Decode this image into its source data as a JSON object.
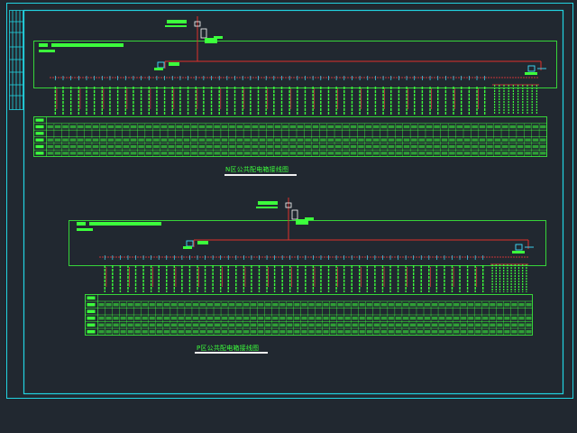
{
  "colors": {
    "background": "#212830",
    "frame": "#22d3e0",
    "wire": "#3cff3c",
    "bus": "#e0302a",
    "accent_red": "#ff3a3a",
    "accent_cyan": "#40e0ff",
    "title_line": "#f0f0f0"
  },
  "diagrams": [
    {
      "title": "N区公共配电箱接线图",
      "columns": 56,
      "tail_columns": 10
    },
    {
      "title": "P区公共配电箱接线图",
      "columns": 50,
      "tail_columns": 10
    }
  ],
  "icons": [
    "breaker-icon",
    "meter-icon",
    "feeder-stub-icon"
  ]
}
